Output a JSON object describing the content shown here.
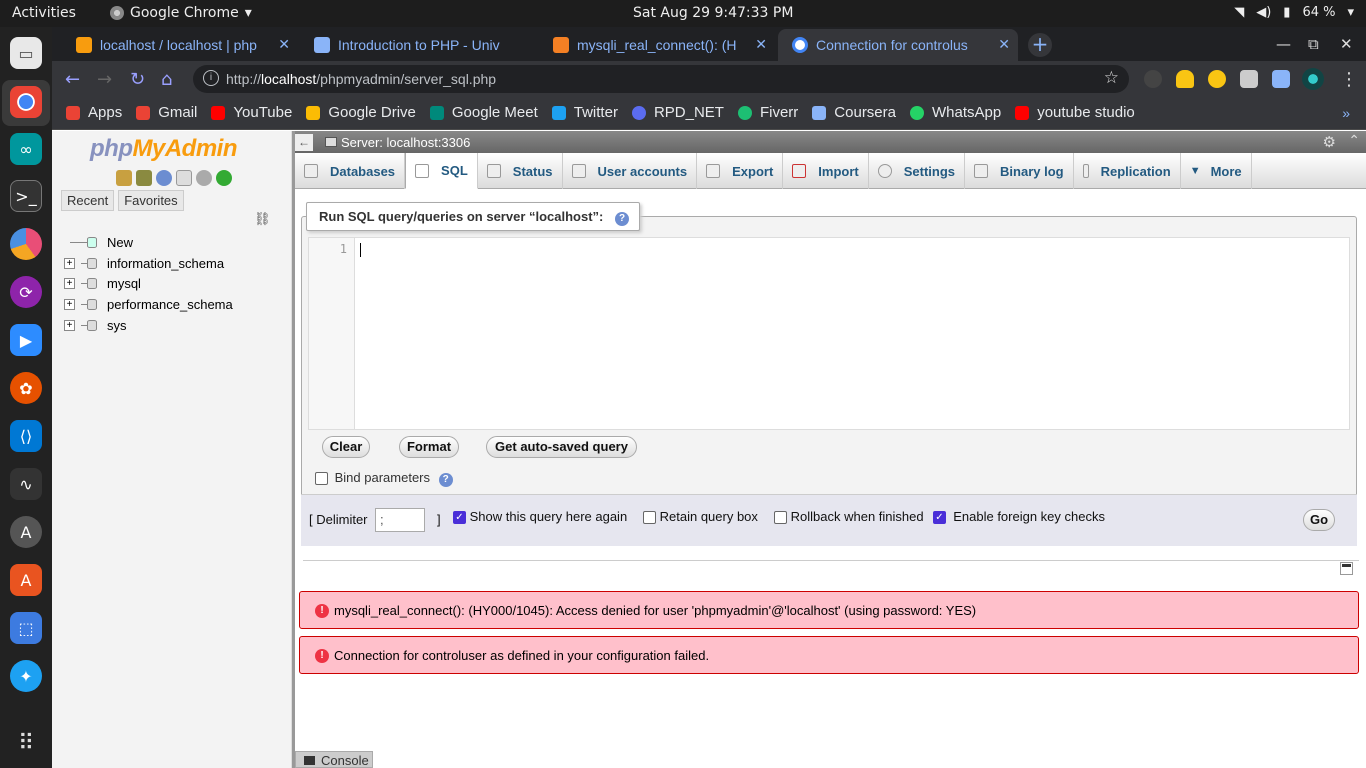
{
  "system": {
    "activities": "Activities",
    "app_name": "Google Chrome",
    "clock": "Sat Aug 29   9:47:33 PM",
    "battery": "64 %"
  },
  "browser": {
    "tabs": [
      {
        "title": "localhost / localhost | php",
        "color": "#f89c0e"
      },
      {
        "title": "Introduction to PHP - Univ",
        "color": "#8ab4f8"
      },
      {
        "title": "mysqli_real_connect(): (H",
        "color": "#f48024"
      },
      {
        "title": "Connection for controlus",
        "color": "#4285f4"
      }
    ],
    "url_prefix": "http://",
    "url_host": "localhost",
    "url_path": "/phpmyadmin/server_sql.php",
    "bookmarks": [
      {
        "label": "Apps",
        "color": "#ea4335"
      },
      {
        "label": "Gmail",
        "color": "#ea4335"
      },
      {
        "label": "YouTube",
        "color": "#ff0000"
      },
      {
        "label": "Google Drive",
        "color": "#fbbc04"
      },
      {
        "label": "Google Meet",
        "color": "#00897b"
      },
      {
        "label": "Twitter",
        "color": "#1da1f2"
      },
      {
        "label": "RPD_NET",
        "color": "#5b6cf0"
      },
      {
        "label": "Fiverr",
        "color": "#1dbf73"
      },
      {
        "label": "Coursera",
        "color": "#8ab4f8"
      },
      {
        "label": "WhatsApp",
        "color": "#25d366"
      },
      {
        "label": "youtube studio",
        "color": "#ff0000"
      }
    ]
  },
  "pma": {
    "logo_php": "php",
    "logo_myadmin": "MyAdmin",
    "nav_tabs": [
      "Recent",
      "Favorites"
    ],
    "tree": [
      {
        "label": "New",
        "kind": "new"
      },
      {
        "label": "information_schema",
        "kind": "db"
      },
      {
        "label": "mysql",
        "kind": "db"
      },
      {
        "label": "performance_schema",
        "kind": "db"
      },
      {
        "label": "sys",
        "kind": "db"
      }
    ],
    "server_label": "Server: localhost:3306",
    "menu": [
      {
        "label": "Databases",
        "icon": "database-icon"
      },
      {
        "label": "SQL",
        "icon": "sql-icon"
      },
      {
        "label": "Status",
        "icon": "status-icon"
      },
      {
        "label": "User accounts",
        "icon": "users-icon"
      },
      {
        "label": "Export",
        "icon": "export-icon"
      },
      {
        "label": "Import",
        "icon": "import-icon"
      },
      {
        "label": "Settings",
        "icon": "settings-icon"
      },
      {
        "label": "Binary log",
        "icon": "binlog-icon"
      },
      {
        "label": "Replication",
        "icon": "replication-icon"
      },
      {
        "label": "More",
        "icon": "chevron-down-icon"
      }
    ],
    "active_tab": "SQL",
    "legend": "Run SQL query/queries on server “localhost”:",
    "line_number": "1",
    "buttons": {
      "clear": "Clear",
      "format": "Format",
      "autosaved": "Get auto-saved query",
      "go": "Go"
    },
    "bind_parameters": "Bind parameters",
    "delimiter_open": "[ Delimiter",
    "delimiter_value": ";",
    "delimiter_close": "]",
    "options": [
      {
        "label": "Show this query here again",
        "checked": true
      },
      {
        "label": "Retain query box",
        "checked": false
      },
      {
        "label": "Rollback when finished",
        "checked": false
      },
      {
        "label": "Enable foreign key checks",
        "checked": true
      }
    ],
    "errors": [
      "mysqli_real_connect(): (HY000/1045): Access denied for user 'phpmyadmin'@'localhost' (using password: YES)",
      "Connection for controluser as defined in your configuration failed."
    ],
    "console": "Console"
  }
}
